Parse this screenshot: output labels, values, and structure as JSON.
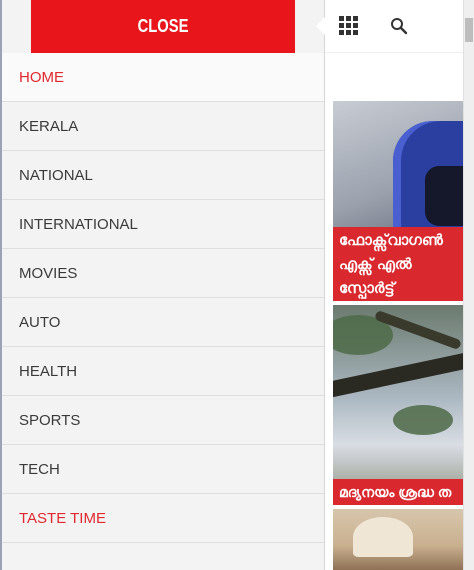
{
  "drawer": {
    "close_label": "CLOSE",
    "menu_items": [
      {
        "label": "HOME"
      },
      {
        "label": "KERALA"
      },
      {
        "label": "NATIONAL"
      },
      {
        "label": "INTERNATIONAL"
      },
      {
        "label": "MOVIES"
      },
      {
        "label": "AUTO"
      },
      {
        "label": "HEALTH"
      },
      {
        "label": "SPORTS"
      },
      {
        "label": "TECH"
      },
      {
        "label": "TASTE TIME"
      }
    ]
  },
  "topbar": {
    "grid_icon": "apps-grid-icon",
    "search_icon": "search-icon"
  },
  "articles": [
    {
      "title": "ഫോക്സ്‌വാഗൺ എക്സ് എൽ സ്പോർട്ട്"
    },
    {
      "title": "മദ്യനയം ശ്രദ്ധ ത"
    },
    {
      "title": ""
    }
  ],
  "colors": {
    "accent": "#e8151b",
    "menu_text": "#3a3a3a",
    "active_text": "#e0282e",
    "drawer_bg": "#f3f3f3"
  }
}
